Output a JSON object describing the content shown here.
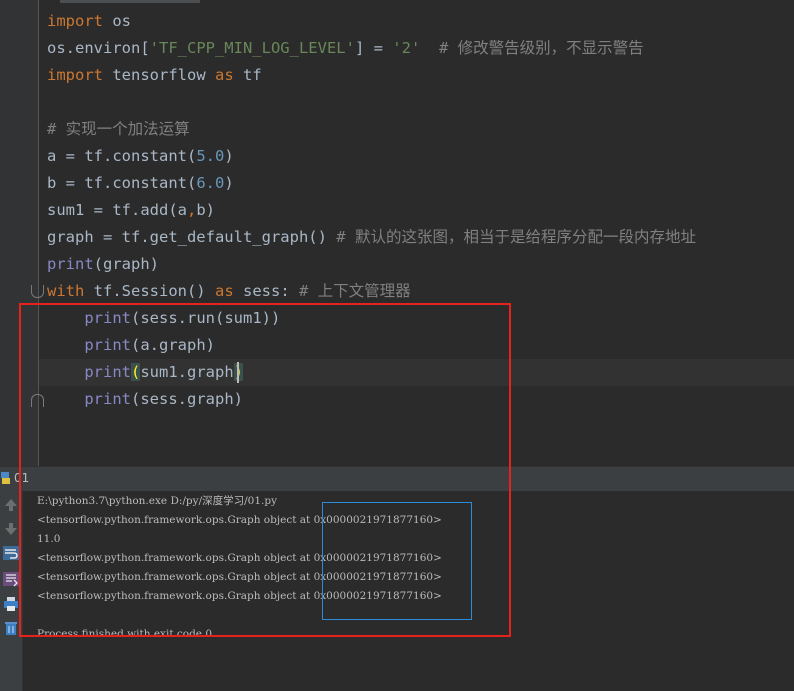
{
  "editor": {
    "lines": [
      {
        "tokens": [
          {
            "t": "import",
            "c": "kw"
          },
          {
            "t": " os",
            "c": ""
          }
        ]
      },
      {
        "tokens": [
          {
            "t": "os.environ[",
            "c": ""
          },
          {
            "t": "'TF_CPP_MIN_LOG_LEVEL'",
            "c": "str"
          },
          {
            "t": "] = ",
            "c": ""
          },
          {
            "t": "'2'",
            "c": "str"
          },
          {
            "t": "  # 修改警告级别，不显示警告",
            "c": "cm"
          }
        ]
      },
      {
        "tokens": [
          {
            "t": "import",
            "c": "kw"
          },
          {
            "t": " tensorflow ",
            "c": ""
          },
          {
            "t": "as",
            "c": "kw"
          },
          {
            "t": " tf",
            "c": ""
          }
        ]
      },
      {
        "tokens": []
      },
      {
        "tokens": [
          {
            "t": "# 实现一个加法运算",
            "c": "cm"
          }
        ]
      },
      {
        "tokens": [
          {
            "t": "a = tf.constant(",
            "c": ""
          },
          {
            "t": "5.0",
            "c": "num"
          },
          {
            "t": ")",
            "c": ""
          }
        ]
      },
      {
        "tokens": [
          {
            "t": "b = tf.constant(",
            "c": ""
          },
          {
            "t": "6.0",
            "c": "num"
          },
          {
            "t": ")",
            "c": ""
          }
        ]
      },
      {
        "tokens": [
          {
            "t": "sum1 = tf.add(a",
            "c": ""
          },
          {
            "t": ",",
            "c": "kw"
          },
          {
            "t": "b)",
            "c": ""
          }
        ]
      },
      {
        "tokens": [
          {
            "t": "graph = tf.get_default_graph() ",
            "c": ""
          },
          {
            "t": "# 默认的这张图，相当于是给程序分配一段内存地址",
            "c": "cm"
          }
        ]
      },
      {
        "tokens": [
          {
            "t": "print",
            "c": "bi"
          },
          {
            "t": "(graph)",
            "c": ""
          }
        ]
      },
      {
        "tokens": [
          {
            "t": "with",
            "c": "kw"
          },
          {
            "t": " tf.Session() ",
            "c": ""
          },
          {
            "t": "as",
            "c": "kw"
          },
          {
            "t": " sess: ",
            "c": ""
          },
          {
            "t": "# 上下文管理器",
            "c": "cm"
          }
        ]
      },
      {
        "tokens": [
          {
            "t": "    ",
            "c": ""
          },
          {
            "t": "print",
            "c": "bi"
          },
          {
            "t": "(sess.run(sum1))",
            "c": ""
          }
        ]
      },
      {
        "tokens": [
          {
            "t": "    ",
            "c": ""
          },
          {
            "t": "print",
            "c": "bi"
          },
          {
            "t": "(a.graph)",
            "c": ""
          }
        ]
      },
      {
        "tokens": [
          {
            "t": "    ",
            "c": ""
          },
          {
            "t": "print",
            "c": "bi"
          },
          {
            "t": "(",
            "c": "match"
          },
          {
            "t": "sum1.graph",
            "c": ""
          },
          {
            "t": ")",
            "c": "match"
          }
        ]
      },
      {
        "tokens": [
          {
            "t": "    ",
            "c": ""
          },
          {
            "t": "print",
            "c": "bi"
          },
          {
            "t": "(sess.graph)",
            "c": ""
          }
        ]
      }
    ]
  },
  "run_panel": {
    "tab_label": "01",
    "output": [
      "E:\\python3.7\\python.exe D:/py/深度学习/01.py",
      "<tensorflow.python.framework.ops.Graph object at 0x0000021971877160>",
      "11.0",
      "<tensorflow.python.framework.ops.Graph object at 0x0000021971877160>",
      "<tensorflow.python.framework.ops.Graph object at 0x0000021971877160>",
      "<tensorflow.python.framework.ops.Graph object at 0x0000021971877160>",
      "",
      "Process finished with exit code 0"
    ],
    "toolbar_icons": [
      "up-arrow-icon",
      "down-arrow-icon",
      "soft-wrap-icon",
      "scroll-to-end-icon",
      "print-icon",
      "trash-icon"
    ]
  },
  "colors": {
    "annotation_red": "#e5221c",
    "annotation_blue": "#2c8bd8"
  }
}
